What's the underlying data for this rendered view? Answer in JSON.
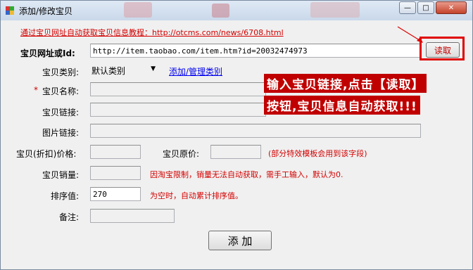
{
  "window": {
    "title": "添加/修改宝贝",
    "accent": "#c9d8ea"
  },
  "tutorial_link": "通过宝贝网址自动获取宝贝信息教程：http://otcms.com/news/6708.html",
  "form": {
    "url_label": "宝贝网址或Id:",
    "url_value": "http://item.taobao.com/item.htm?id=20032474973",
    "read_button": "读取",
    "category_label": "宝贝类别:",
    "category_value": "默认类别",
    "manage_category_link": "添加/管理类别",
    "name_label": "宝贝名称:",
    "name_required_marker": "*",
    "link_label": "宝贝链接:",
    "image_label": "图片链接:",
    "price_label": "宝贝(折扣)价格:",
    "original_price_label": "宝贝原价:",
    "original_price_hint": "(部分特效模板会用到该字段)",
    "sales_label": "宝贝销量:",
    "sales_hint": "因淘宝限制，销量无法自动获取，需手工输入，默认为0.",
    "sort_label": "排序值:",
    "sort_value": "270",
    "sort_hint": "为空时，自动累计排序值。",
    "note_label": "备注:",
    "add_button": "添 加"
  },
  "annotation": {
    "line1": "输入宝贝链接,点击【读取】",
    "line2": "按钮,宝贝信息自动获取!!!",
    "highlight_color": "#e00000"
  }
}
